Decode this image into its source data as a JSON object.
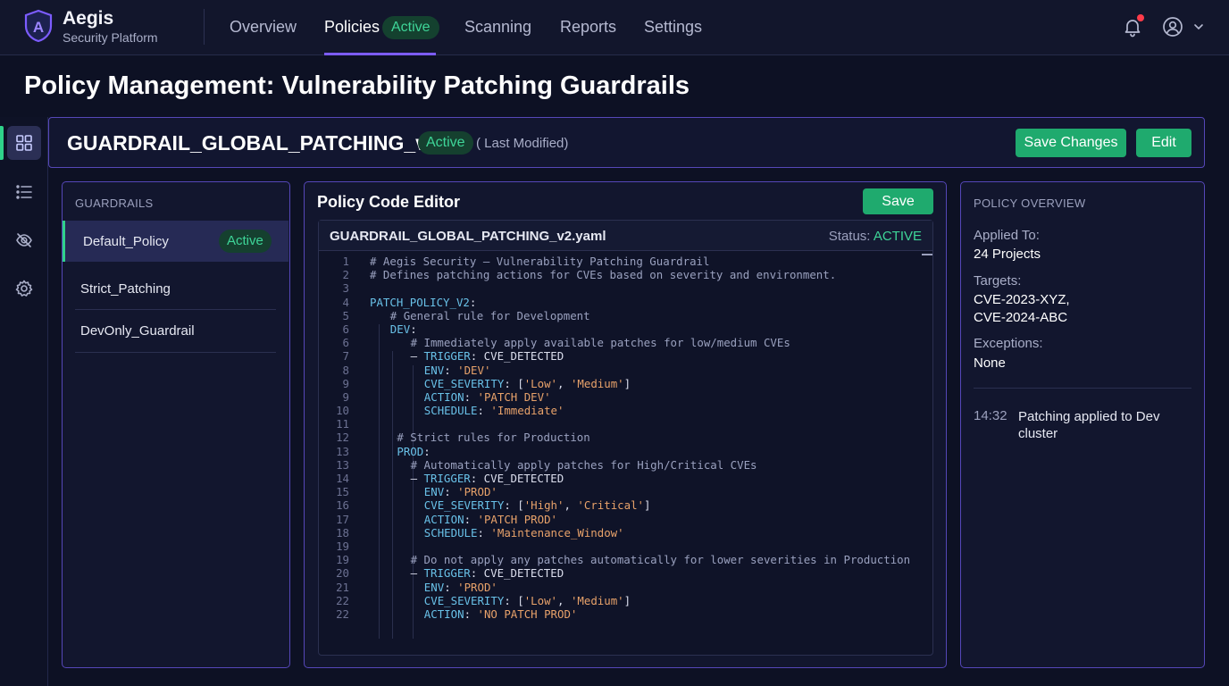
{
  "brand": {
    "name": "Aegis",
    "subtitle": "Security Platform",
    "logo_letter": "A"
  },
  "nav": {
    "items": [
      "Overview",
      "Policies",
      "Scanning",
      "Reports",
      "Settings"
    ],
    "active": "Policies",
    "active_badge": "Active"
  },
  "header_icons": {
    "notifications": "bell-icon",
    "account": "user-circle-icon",
    "menu": "chevron-down-icon",
    "has_unread": true
  },
  "page": {
    "title": "Policy Management: Vulnerability Patching Guardrails"
  },
  "rail": {
    "icons": [
      "grid-icon",
      "list-icon",
      "eye-off-icon",
      "gear-icon"
    ],
    "active_index": 0
  },
  "policy": {
    "name": "GUARDRAIL_GLOBAL_PATCHING_v2",
    "status": "Active",
    "modified": "( Last Modified)",
    "save_changes_label": "Save Changes",
    "edit_label": "Edit"
  },
  "guardrails": {
    "label": "GUARDRAILS",
    "items": [
      {
        "name": "Default_Policy",
        "badge": "Active"
      },
      {
        "name": "Strict_Patching"
      },
      {
        "name": "DevOnly_Guardrail"
      }
    ],
    "active_index": 0
  },
  "editor": {
    "title": "Policy Code Editor",
    "save_label": "Save",
    "file_name": "GUARDRAIL_GLOBAL_PATCHING_v2.yaml",
    "status_label": "Status:",
    "status_value": "ACTIVE",
    "lines": [
      {
        "n": "1",
        "indent": 0,
        "parts": [
          [
            "c",
            "# Aegis Security – Vulnerability Patching Guardrail"
          ]
        ]
      },
      {
        "n": "2",
        "indent": 0,
        "parts": [
          [
            "c",
            "# Defines patching actions for CVEs based on severity and environment."
          ]
        ]
      },
      {
        "n": "3",
        "indent": 0,
        "parts": []
      },
      {
        "n": "4",
        "indent": 0,
        "parts": [
          [
            "k",
            "PATCH_POLICY_V2"
          ],
          [
            "t",
            ":"
          ]
        ]
      },
      {
        "n": "5",
        "indent": 3,
        "parts": [
          [
            "c",
            "# General rule for Development"
          ]
        ]
      },
      {
        "n": "6",
        "indent": 3,
        "parts": [
          [
            "k",
            "DEV"
          ],
          [
            "t",
            ":"
          ]
        ]
      },
      {
        "n": "6",
        "indent": 6,
        "parts": [
          [
            "c",
            "# Immediately apply available patches for low/medium CVEs"
          ]
        ]
      },
      {
        "n": "7",
        "indent": 6,
        "parts": [
          [
            "t",
            "– "
          ],
          [
            "k",
            "TRIGGER"
          ],
          [
            "t",
            ": CVE_DETECTED"
          ]
        ]
      },
      {
        "n": "8",
        "indent": 8,
        "parts": [
          [
            "k",
            "ENV"
          ],
          [
            "t",
            ": "
          ],
          [
            "s",
            "'DEV'"
          ]
        ]
      },
      {
        "n": "9",
        "indent": 8,
        "parts": [
          [
            "k",
            "CVE_SEVERITY"
          ],
          [
            "t",
            ": ["
          ],
          [
            "s",
            "'Low'"
          ],
          [
            "t",
            ", "
          ],
          [
            "s",
            "'Medium'"
          ],
          [
            "t",
            "]"
          ]
        ]
      },
      {
        "n": "9",
        "indent": 8,
        "parts": [
          [
            "k",
            "ACTION"
          ],
          [
            "t",
            ": "
          ],
          [
            "s",
            "'PATCH DEV'"
          ]
        ]
      },
      {
        "n": "10",
        "indent": 8,
        "parts": [
          [
            "k",
            "SCHEDULE"
          ],
          [
            "t",
            ": "
          ],
          [
            "s",
            "'Immediate'"
          ]
        ]
      },
      {
        "n": "11",
        "indent": 0,
        "parts": []
      },
      {
        "n": "12",
        "indent": 4,
        "parts": [
          [
            "c",
            "# Strict rules for Production"
          ]
        ]
      },
      {
        "n": "13",
        "indent": 4,
        "parts": [
          [
            "k",
            "PROD"
          ],
          [
            "t",
            ":"
          ]
        ]
      },
      {
        "n": "13",
        "indent": 6,
        "parts": [
          [
            "c",
            "# Automatically apply patches for High/Critical CVEs"
          ]
        ]
      },
      {
        "n": "14",
        "indent": 6,
        "parts": [
          [
            "t",
            "– "
          ],
          [
            "k",
            "TRIGGER"
          ],
          [
            "t",
            ": CVE_DETECTED"
          ]
        ]
      },
      {
        "n": "15",
        "indent": 8,
        "parts": [
          [
            "k",
            "ENV"
          ],
          [
            "t",
            ": "
          ],
          [
            "s",
            "'PROD'"
          ]
        ]
      },
      {
        "n": "16",
        "indent": 8,
        "parts": [
          [
            "k",
            "CVE_SEVERITY"
          ],
          [
            "t",
            ": ["
          ],
          [
            "s",
            "'High'"
          ],
          [
            "t",
            ", "
          ],
          [
            "s",
            "'Critical'"
          ],
          [
            "t",
            "]"
          ]
        ]
      },
      {
        "n": "17",
        "indent": 8,
        "parts": [
          [
            "k",
            "ACTION"
          ],
          [
            "t",
            ": "
          ],
          [
            "s",
            "'PATCH PROD'"
          ]
        ]
      },
      {
        "n": "18",
        "indent": 8,
        "parts": [
          [
            "k",
            "SCHEDULE"
          ],
          [
            "t",
            ": "
          ],
          [
            "s",
            "'Maintenance_Window'"
          ]
        ]
      },
      {
        "n": "19",
        "indent": 0,
        "parts": []
      },
      {
        "n": "19",
        "indent": 6,
        "parts": [
          [
            "c",
            "# Do not apply any patches automatically for lower severities in Production"
          ]
        ]
      },
      {
        "n": "20",
        "indent": 6,
        "parts": [
          [
            "t",
            "– "
          ],
          [
            "k",
            "TRIGGER"
          ],
          [
            "t",
            ": CVE_DETECTED"
          ]
        ]
      },
      {
        "n": "21",
        "indent": 8,
        "parts": [
          [
            "k",
            "ENV"
          ],
          [
            "t",
            ": "
          ],
          [
            "s",
            "'PROD'"
          ]
        ]
      },
      {
        "n": "22",
        "indent": 8,
        "parts": [
          [
            "k",
            "CVE_SEVERITY"
          ],
          [
            "t",
            ": ["
          ],
          [
            "s",
            "'Low'"
          ],
          [
            "t",
            ", "
          ],
          [
            "s",
            "'Medium'"
          ],
          [
            "t",
            "]"
          ]
        ]
      },
      {
        "n": "22",
        "indent": 8,
        "parts": [
          [
            "k",
            "ACTION"
          ],
          [
            "t",
            ": "
          ],
          [
            "s",
            "'NO PATCH PROD'"
          ]
        ]
      }
    ]
  },
  "overview": {
    "label": "POLICY OVERVIEW",
    "applied_to_label": "Applied To:",
    "applied_to_value": "24 Projects",
    "targets_label": "Targets:",
    "targets": [
      "CVE-2023-XYZ,",
      "CVE-2024-ABC"
    ],
    "exceptions_label": "Exceptions:",
    "exceptions_value": "None",
    "log": {
      "time": "14:32",
      "text": "Patching applied to Dev cluster"
    }
  },
  "colors": {
    "accent": "#7c5cff",
    "panel_border": "#5547b8",
    "success": "#3ed598",
    "primary_button": "#1faa6e",
    "alert": "#ff3b4a",
    "code_key": "#69c1e8",
    "code_string": "#e8a26a",
    "code_comment": "#9aa1bf"
  }
}
